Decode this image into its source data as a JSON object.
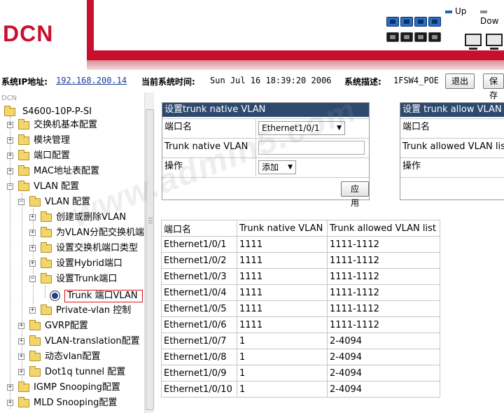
{
  "header": {
    "logo": "DCN",
    "legend_up": "Up",
    "legend_down": "Dow",
    "legend_up_color": "#1f5fbf",
    "legend_down_color": "#8a8a8a"
  },
  "infobar": {
    "ip_label": "系统IP地址:",
    "ip_value": "192.168.200.14",
    "time_label": "当前系统时间:",
    "time_value": "Sun Jul 16 18:39:20 2006",
    "desc_label": "系统描述:",
    "desc_value": "1FSW4_POE",
    "logout_button": "退出",
    "save_button": "保存"
  },
  "tree": {
    "root_label": "DCN",
    "device": "S4600-10P-P-SI",
    "items": [
      {
        "label": "交换机基本配置"
      },
      {
        "label": "模块管理"
      },
      {
        "label": "端口配置"
      },
      {
        "label": "MAC地址表配置"
      },
      {
        "label": "VLAN 配置"
      },
      {
        "label": "VLAN 配置"
      },
      {
        "label": "创建或删除VLAN"
      },
      {
        "label": "为VLAN分配交换机端"
      },
      {
        "label": "设置交换机端口类型"
      },
      {
        "label": "设置Hybrid端口"
      },
      {
        "label": "设置Trunk端口"
      },
      {
        "label": "Trunk 端口VLAN"
      },
      {
        "label": "Private-vlan 控制"
      },
      {
        "label": "GVRP配置"
      },
      {
        "label": "VLAN-translation配置"
      },
      {
        "label": "动态vlan配置"
      },
      {
        "label": "Dot1q tunnel 配置"
      },
      {
        "label": "IGMP Snooping配置"
      },
      {
        "label": "MLD Snooping配置"
      }
    ]
  },
  "native_panel": {
    "title": "设置trunk native VLAN",
    "port_label": "端口名",
    "port_value": "Ethernet1/0/1",
    "native_label": "Trunk native VLAN",
    "native_value": "",
    "op_label": "操作",
    "op_value": "添加",
    "apply_button": "应用"
  },
  "allow_panel": {
    "title": "设置  trunk allow VLAN",
    "port_label": "端口名",
    "allowed_label": "Trunk allowed VLAN list",
    "op_label": "操作"
  },
  "table": {
    "headers": [
      "端口名",
      "Trunk native VLAN",
      "Trunk allowed VLAN list"
    ],
    "rows": [
      [
        "Ethernet1/0/1",
        "1111",
        "1111-1112"
      ],
      [
        "Ethernet1/0/2",
        "1111",
        "1111-1112"
      ],
      [
        "Ethernet1/0/3",
        "1111",
        "1111-1112"
      ],
      [
        "Ethernet1/0/4",
        "1111",
        "1111-1112"
      ],
      [
        "Ethernet1/0/5",
        "1111",
        "1111-1112"
      ],
      [
        "Ethernet1/0/6",
        "1111",
        "1111-1112"
      ],
      [
        "Ethernet1/0/7",
        "1",
        "2-4094"
      ],
      [
        "Ethernet1/0/8",
        "1",
        "2-4094"
      ],
      [
        "Ethernet1/0/9",
        "1",
        "2-4094"
      ],
      [
        "Ethernet1/0/10",
        "1",
        "2-4094"
      ]
    ]
  },
  "watermark": "www.admin5.com"
}
